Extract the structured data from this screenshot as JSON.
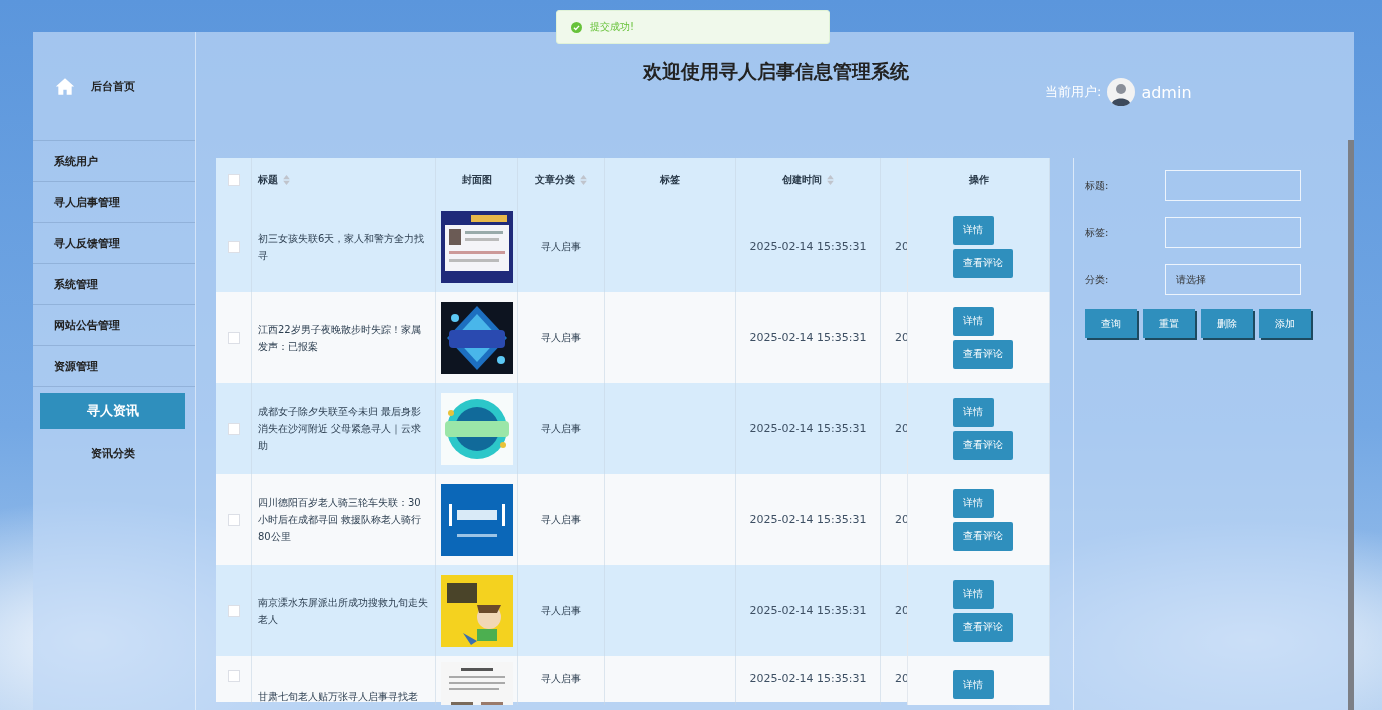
{
  "toast": {
    "kind": "success",
    "message": "提交成功!"
  },
  "header": {
    "title": "欢迎使用寻人启事信息管理系统",
    "user_label": "当前用户:",
    "username": "admin"
  },
  "sidebar": {
    "home": "后台首页",
    "items": [
      {
        "label": "系统用户",
        "selected": false
      },
      {
        "label": "寻人启事管理",
        "selected": false
      },
      {
        "label": "寻人反馈管理",
        "selected": false
      },
      {
        "label": "系统管理",
        "selected": false
      },
      {
        "label": "网站公告管理",
        "selected": false
      },
      {
        "label": "资源管理",
        "selected": false,
        "children": [
          {
            "label": "寻人资讯",
            "selected": true
          },
          {
            "label": "资讯分类",
            "selected": false
          }
        ]
      }
    ]
  },
  "table": {
    "all_checked": false,
    "columns": [
      {
        "label": "标题",
        "sortable": true
      },
      {
        "label": "封面图",
        "sortable": false
      },
      {
        "label": "文章分类",
        "sortable": true
      },
      {
        "label": "标签",
        "sortable": false
      },
      {
        "label": "创建时间",
        "sortable": true
      },
      {
        "label": "操作",
        "sortable": false
      }
    ],
    "rows": [
      {
        "title": "初三女孩失联6天，家人和警方全力找寻",
        "cover": {
          "kind": "picture"
        },
        "category": "寻人启事",
        "created": "2025-02-14 15:35:31",
        "column_7": "20",
        "actions": [
          "详情",
          "查看评论"
        ],
        "checked": false
      },
      {
        "title": "江西22岁男子夜晚散步时失踪！家属发声：已报案",
        "cover": {
          "kind": "picture"
        },
        "category": "寻人启事",
        "created": "2025-02-14 15:35:31",
        "column_7": "20",
        "actions": [
          "详情",
          "查看评论"
        ],
        "checked": false
      },
      {
        "title": "成都女子除夕失联至今未归 最后身影消失在沙河附近 父母紧急寻人｜云求助",
        "cover": {
          "kind": "picture"
        },
        "category": "寻人启事",
        "created": "2025-02-14 15:35:31",
        "column_7": "20",
        "actions": [
          "详情",
          "查看评论"
        ],
        "checked": false
      },
      {
        "title": "四川德阳百岁老人骑三轮车失联：30小时后在成都寻回 救援队称老人骑行80公里",
        "cover": {
          "kind": "picture"
        },
        "category": "寻人启事",
        "created": "2025-02-14 15:35:31",
        "column_7": "20",
        "actions": [
          "详情",
          "查看评论"
        ],
        "checked": false
      },
      {
        "title": "南京溧水东屏派出所成功搜救九旬走失老人",
        "cover": {
          "kind": "picture"
        },
        "category": "寻人启事",
        "created": "2025-02-14 15:35:31",
        "column_7": "20",
        "actions": [
          "详情",
          "查看评论"
        ],
        "checked": false
      },
      {
        "title": "甘肃七旬老人贴万张寻人启事寻找老",
        "cover": {
          "kind": "picture"
        },
        "category": "寻人启事",
        "created": "2025-02-14 15:35:31",
        "column_7": "20",
        "actions": [
          "详情"
        ],
        "checked": false
      }
    ]
  },
  "search": {
    "fields": [
      {
        "label": "标题:",
        "kind": "text"
      },
      {
        "label": "标签:",
        "kind": "text"
      },
      {
        "label": "分类:",
        "kind": "select",
        "placeholder": "请选择"
      }
    ],
    "buttons": [
      "查询",
      "重置",
      "删除",
      "添加"
    ]
  }
}
